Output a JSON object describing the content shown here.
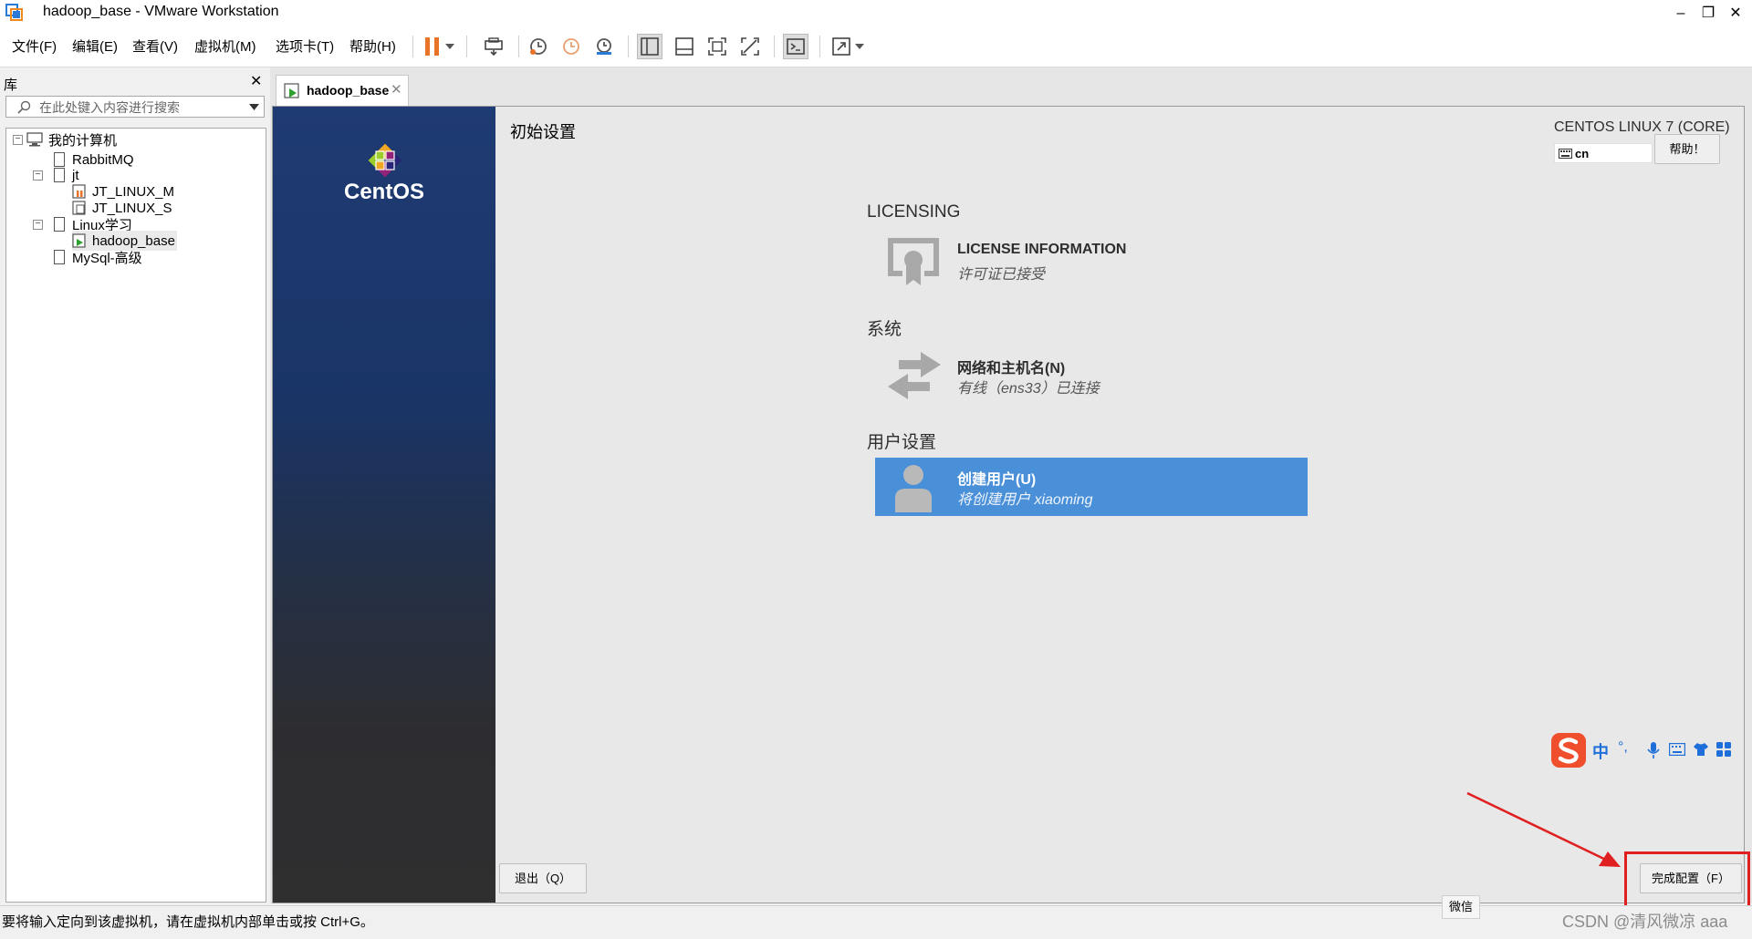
{
  "window": {
    "title": "hadoop_base - VMware Workstation",
    "minimize": "–",
    "restore": "❐",
    "close": "✕"
  },
  "menu": [
    "文件(F)",
    "编辑(E)",
    "查看(V)",
    "虚拟机(M)",
    "选项卡(T)",
    "帮助(H)"
  ],
  "toolbar_icons": [
    "pause-icon",
    "send-ctrl-alt-del-icon",
    "snapshot-icon",
    "revert-snapshot-icon",
    "snapshot-manager-icon",
    "library-view-icon",
    "thumbnail-view-icon",
    "fullscreen-icon",
    "unity-icon",
    "console-icon",
    "stretch-icon"
  ],
  "library": {
    "title": "库",
    "close": "✕",
    "search_placeholder": "在此处键入内容进行搜索",
    "tree": {
      "root": "我的计算机",
      "rabbitmq": "RabbitMQ",
      "jt": "jt",
      "jt_linux_m": "JT_LINUX_M",
      "jt_linux_s": "JT_LINUX_S",
      "linux_study": "Linux学习",
      "hadoop_base": "hadoop_base",
      "mysql": "MySql-高级"
    }
  },
  "tab": {
    "label": "hadoop_base",
    "close": "✕"
  },
  "guest": {
    "brand": "CentOS",
    "spoke_title": "初始设置",
    "os_name": "CENTOS LINUX 7 (CORE)",
    "keyboard": "cn",
    "help_button": "帮助！",
    "licensing": {
      "category": "LICENSING",
      "title": "LICENSE INFORMATION",
      "status": "许可证已接受"
    },
    "system": {
      "category": "系统",
      "title": "网络和主机名(N)",
      "status": "有线（ens33）已连接"
    },
    "user": {
      "category": "用户设置",
      "title": "创建用户(U)",
      "status": "将创建用户 xiaoming"
    },
    "quit_button": "退出（Q）",
    "finish_button": "完成配置（F）"
  },
  "ime": {
    "chinese": "中",
    "punct": "°,"
  },
  "status": {
    "text": "要将输入定向到该虚拟机，请在虚拟机内部单击或按 Ctrl+G。",
    "wechat_tip": "微信",
    "watermark": "CSDN @清风微凉 aaa"
  },
  "colors": {
    "user_spoke_bg": "#4a90d9",
    "vm_pause_orange": "#e8742a",
    "annotation_red": "#e02020"
  }
}
